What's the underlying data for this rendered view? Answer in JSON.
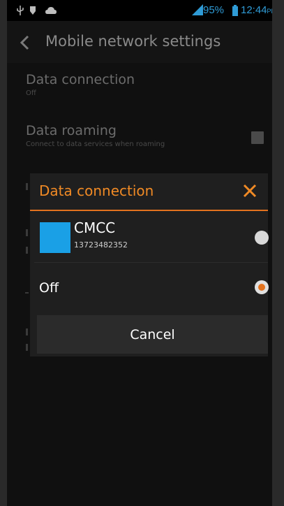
{
  "status_bar": {
    "icons": [
      "usb-icon",
      "shield-icon",
      "cloud-icon",
      "signal-icon",
      "battery-icon"
    ],
    "battery": "95%",
    "time": "12:44",
    "ampm": "PM"
  },
  "action_bar": {
    "back_icon": "back-arrow-icon",
    "title": "Mobile network settings"
  },
  "settings": {
    "data_connection": {
      "title": "Data connection",
      "summary": "Off"
    },
    "data_roaming": {
      "title": "Data roaming",
      "summary": "Connect to data services when roaming",
      "checked": false
    }
  },
  "dialog": {
    "title": "Data connection",
    "close_icon": "close-icon",
    "options": [
      {
        "name": "CMCC",
        "number": "13723482352",
        "color": "#1aa0e6",
        "selected": false
      },
      {
        "name": "Off",
        "selected": true
      }
    ],
    "cancel_label": "Cancel"
  },
  "colors": {
    "accent": "#e2721e",
    "status_blue": "#2f9bd6",
    "sim_color": "#1aa0e6"
  }
}
